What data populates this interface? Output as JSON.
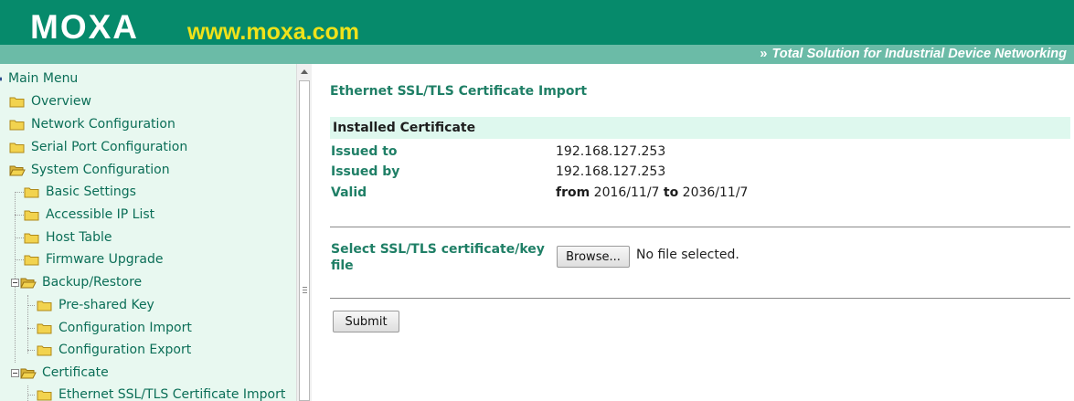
{
  "header": {
    "logo": "MOXA",
    "url": "www.moxa.com",
    "tagline_chevron": "»",
    "tagline": "Total Solution for Industrial Device Networking"
  },
  "sidebar": {
    "items": [
      {
        "label": "Main Menu"
      },
      {
        "label": "Overview"
      },
      {
        "label": "Network Configuration"
      },
      {
        "label": "Serial Port Configuration"
      },
      {
        "label": "System Configuration"
      },
      {
        "label": "Basic Settings"
      },
      {
        "label": "Accessible IP List"
      },
      {
        "label": "Host Table"
      },
      {
        "label": "Firmware Upgrade"
      },
      {
        "label": "Backup/Restore"
      },
      {
        "label": "Pre-shared Key"
      },
      {
        "label": "Configuration Import"
      },
      {
        "label": "Configuration Export"
      },
      {
        "label": "Certificate"
      },
      {
        "label": "Ethernet SSL/TLS Certificate Import"
      }
    ]
  },
  "main": {
    "title": "Ethernet SSL/TLS Certificate Import",
    "installed_header": "Installed Certificate",
    "issued_to_label": "Issued to",
    "issued_to_value": "192.168.127.253",
    "issued_by_label": "Issued by",
    "issued_by_value": "192.168.127.253",
    "valid_label": "Valid",
    "valid_from_word": "from",
    "valid_from_date": "2016/11/7",
    "valid_to_word": "to",
    "valid_to_date": "2036/11/7",
    "select_label": "Select SSL/TLS certificate/key file",
    "browse_label": "Browse...",
    "file_status": "No file selected.",
    "submit_label": "Submit"
  },
  "colors": {
    "header_bg": "#068a6b",
    "tagline_bar": "#6bbba7",
    "url_yellow": "#f0e21a",
    "sidebar_bg": "#e8f8f0",
    "label_green": "#1f7f66",
    "installed_header_bg": "#def8ee",
    "folder_yellow": "#f2d34f"
  }
}
